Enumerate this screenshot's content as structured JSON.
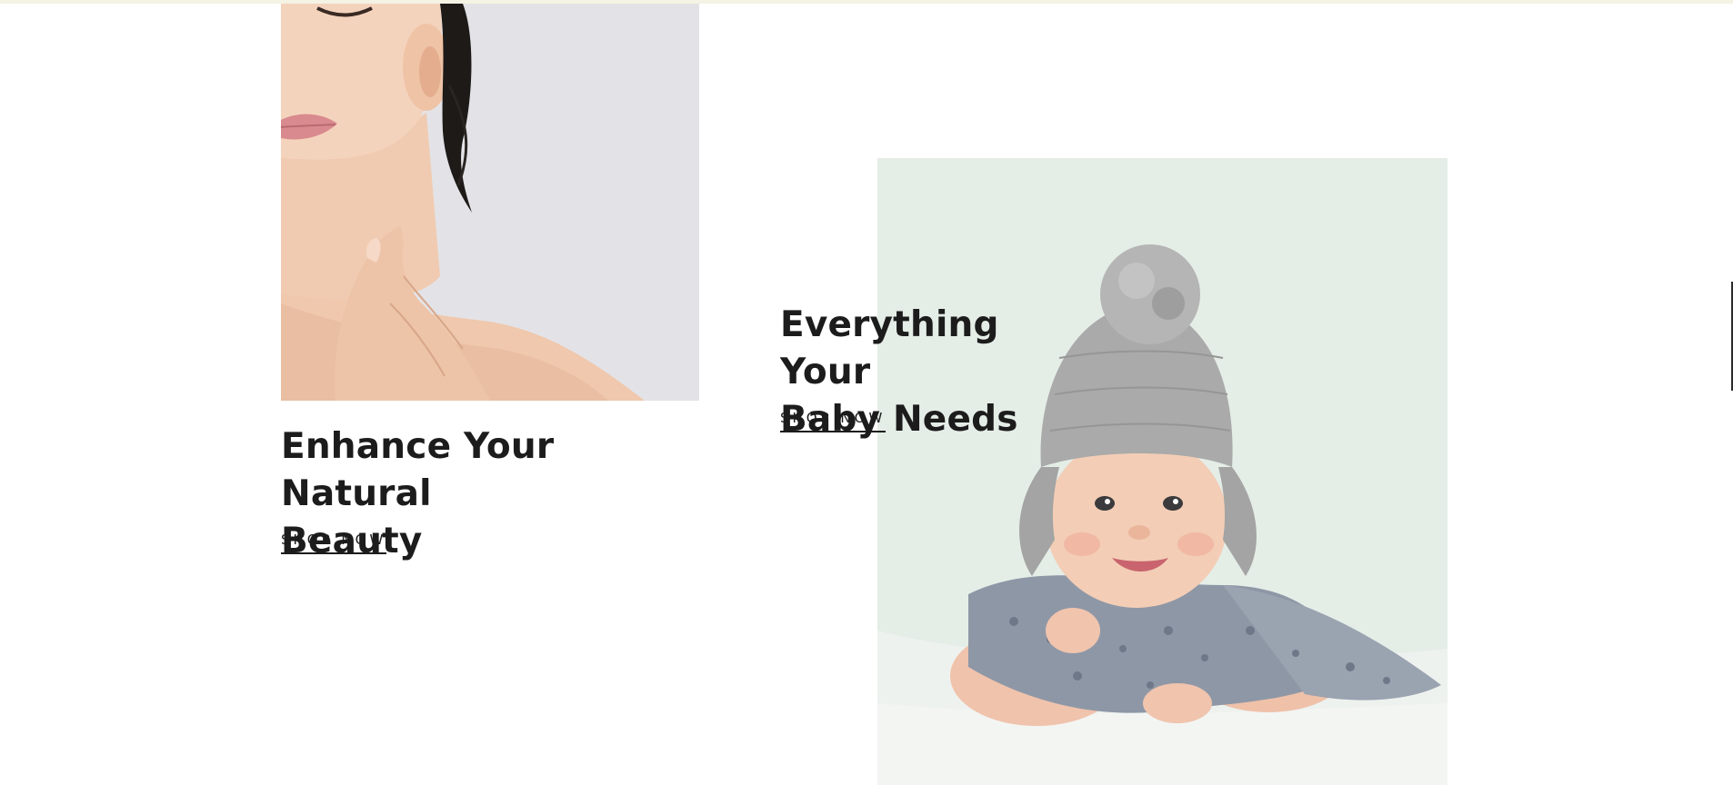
{
  "colors": {
    "text": "#1c1c1c",
    "background": "#ffffff",
    "top_strip": "#f4f3e4",
    "beauty_photo_bg": "#e2e2e6",
    "baby_photo_bg": "#e6eee8"
  },
  "cards": [
    {
      "heading_line1": "Enhance Your Natural",
      "heading_line2": "Beauty",
      "link_label": "SHOP NOW",
      "image": "woman-skincare-photo"
    },
    {
      "heading_line1": "Everything Your",
      "heading_line2": "Baby Needs",
      "link_label": "SHOP NOW",
      "image": "baby-knit-hat-photo"
    }
  ]
}
